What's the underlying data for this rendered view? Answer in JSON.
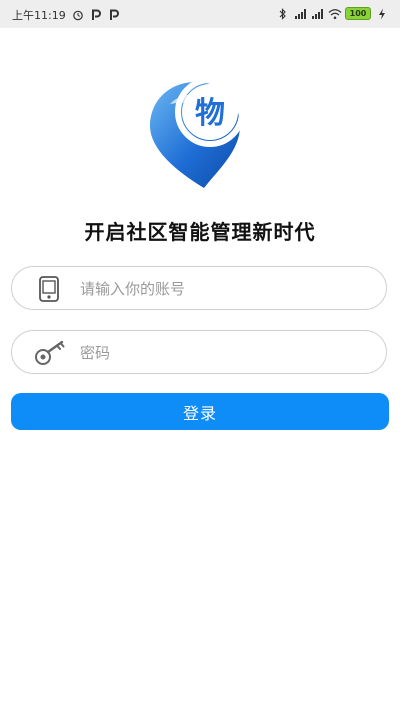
{
  "status_bar": {
    "time": "上午11:19",
    "left_icons": [
      "alarm-icon",
      "p-icon",
      "p-icon"
    ],
    "right_icons": [
      "bluetooth-icon",
      "signal-icon",
      "signal-icon",
      "wifi-icon"
    ],
    "battery_level": "100"
  },
  "logo": {
    "glyph": "物",
    "colors": {
      "primary": "#1f6fd6",
      "light": "#6cb8f2"
    }
  },
  "tagline": "开启社区智能管理新时代",
  "login_form": {
    "account_placeholder": "请输入你的账号",
    "password_placeholder": "密码",
    "submit_label": "登录"
  },
  "colors": {
    "accent": "#0e8cf7",
    "input_border": "#cfcfcf",
    "placeholder": "#9a9a9a"
  }
}
